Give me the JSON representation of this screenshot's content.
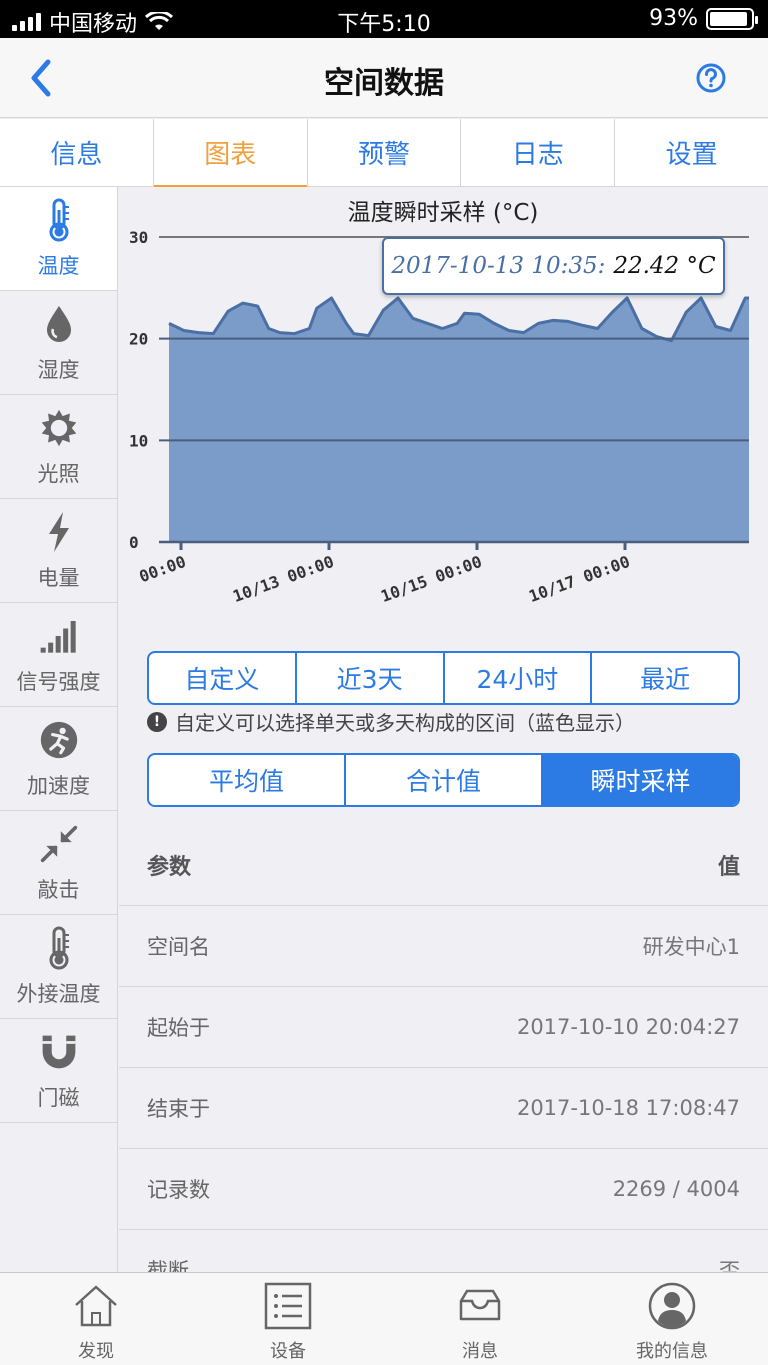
{
  "status": {
    "carrier": "中国移动",
    "time": "下午5:10",
    "battery": "93%",
    "battery_level": 0.93
  },
  "nav": {
    "title": "空间数据"
  },
  "tabs": [
    "信息",
    "图表",
    "预警",
    "日志",
    "设置"
  ],
  "active_tab": 1,
  "sidebar": {
    "items": [
      {
        "label": "温度",
        "icon": "thermometer-icon"
      },
      {
        "label": "湿度",
        "icon": "water-drop-icon"
      },
      {
        "label": "光照",
        "icon": "sun-icon"
      },
      {
        "label": "电量",
        "icon": "lightning-icon"
      },
      {
        "label": "信号强度",
        "icon": "signal-bars-icon"
      },
      {
        "label": "加速度",
        "icon": "accelerometer-icon"
      },
      {
        "label": "敲击",
        "icon": "knock-arrows-icon"
      },
      {
        "label": "外接温度",
        "icon": "external-thermometer-icon"
      },
      {
        "label": "门磁",
        "icon": "magnet-icon"
      }
    ]
  },
  "chart_data": {
    "type": "area",
    "title": "温度瞬时采样 (°C)",
    "ylim": [
      0,
      30
    ],
    "y_ticks": [
      0,
      10,
      20,
      30
    ],
    "x_ticks": [
      "00:00",
      "10/13 00:00",
      "10/15 00:00",
      "10/17 00:00"
    ],
    "x": [
      0,
      0.2,
      0.4,
      0.6,
      0.8,
      1.0,
      1.2,
      1.35,
      1.5,
      1.7,
      1.9,
      2.0,
      2.2,
      2.4,
      2.5,
      2.7,
      2.9,
      3.1,
      3.3,
      3.5,
      3.7,
      3.9,
      4.0,
      4.2,
      4.4,
      4.6,
      4.8,
      5.0,
      5.2,
      5.4,
      5.6,
      5.8,
      6.0,
      6.2,
      6.4,
      6.6,
      6.8,
      7.0,
      7.2,
      7.4,
      7.6,
      7.8,
      7.85
    ],
    "values": [
      21.5,
      20.8,
      20.6,
      20.5,
      22.7,
      23.5,
      23.2,
      21.0,
      20.6,
      20.5,
      21.0,
      23.0,
      24.0,
      21.5,
      20.5,
      20.3,
      22.8,
      24.0,
      22.0,
      21.5,
      21.0,
      21.5,
      22.5,
      22.4,
      21.5,
      20.8,
      20.6,
      21.5,
      21.8,
      21.7,
      21.3,
      21.0,
      22.6,
      24.0,
      21.0,
      20.2,
      19.8,
      22.6,
      24.0,
      21.2,
      20.8,
      24.0,
      24.0
    ],
    "x_unit": "days since 10/12 00:00",
    "grid": true,
    "tooltip": {
      "date": "2017-10-13 10:35:",
      "value": "22.42 °C"
    }
  },
  "range_buttons": [
    "自定义",
    "近3天",
    "24小时",
    "最近"
  ],
  "hint": "自定义可以选择单天或多天构成的区间（蓝色显示）",
  "mode_buttons": [
    "平均值",
    "合计值",
    "瞬时采样"
  ],
  "active_mode": 2,
  "table": {
    "header": {
      "param": "参数",
      "value": "值"
    },
    "rows": [
      {
        "param": "空间名",
        "value": "研发中心1"
      },
      {
        "param": "起始于",
        "value": "2017-10-10 20:04:27"
      },
      {
        "param": "结束于",
        "value": "2017-10-18 17:08:47"
      },
      {
        "param": "记录数",
        "value": "2269 / 4004"
      },
      {
        "param": "截断",
        "value": "否"
      }
    ]
  },
  "tabbar": [
    {
      "label": "发现",
      "icon": "house-icon"
    },
    {
      "label": "设备",
      "icon": "list-icon"
    },
    {
      "label": "消息",
      "icon": "inbox-icon"
    },
    {
      "label": "我的信息",
      "icon": "user-avatar-icon"
    }
  ],
  "colors": {
    "accent": "#2c7be5",
    "active_tab": "#f0a03c",
    "chart_fill": "#7b9bc8",
    "chart_line": "#4a6fa5"
  }
}
